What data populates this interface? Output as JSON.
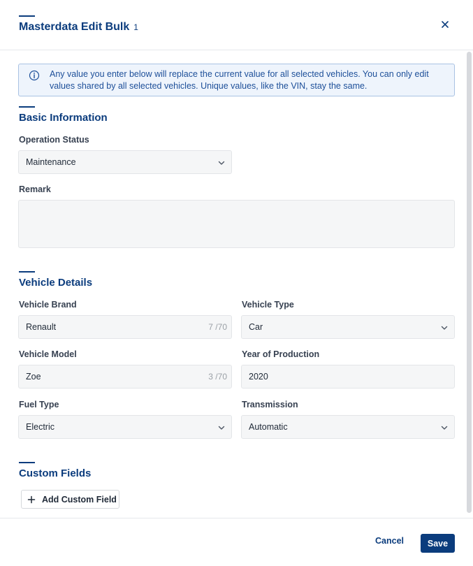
{
  "dialog": {
    "title": "Masterdata Edit Bulk",
    "selected_count": "1"
  },
  "notice": {
    "text": "Any value you enter below will replace the current value for all selected vehicles. You can only edit values shared by all selected vehicles. Unique values, like the VIN, stay the same."
  },
  "basic_information": {
    "title": "Basic Information",
    "operation_status": {
      "label": "Operation Status",
      "value": "Maintenance"
    },
    "remark": {
      "label": "Remark",
      "value": ""
    }
  },
  "vehicle_details": {
    "title": "Vehicle Details",
    "vehicle_brand": {
      "label": "Vehicle Brand",
      "value": "Renault",
      "counter": "7 /70"
    },
    "vehicle_type": {
      "label": "Vehicle Type",
      "value": "Car"
    },
    "vehicle_model": {
      "label": "Vehicle Model",
      "value": "Zoe",
      "counter": "3 /70"
    },
    "year_of_production": {
      "label": "Year of Production",
      "value": "2020"
    },
    "fuel_type": {
      "label": "Fuel Type",
      "value": "Electric"
    },
    "transmission": {
      "label": "Transmission",
      "value": "Automatic"
    }
  },
  "custom_fields": {
    "title": "Custom Fields",
    "add_label": "Add Custom Field"
  },
  "footer": {
    "cancel_label": "Cancel",
    "save_label": "Save"
  },
  "colors": {
    "accent": "#0b3c7d",
    "notice_bg": "#eef4fc",
    "notice_border": "#a9c2e3",
    "field_bg": "#f5f6f7"
  },
  "icons": [
    "close-icon",
    "info-icon",
    "chevron-down-icon",
    "plus-icon"
  ]
}
